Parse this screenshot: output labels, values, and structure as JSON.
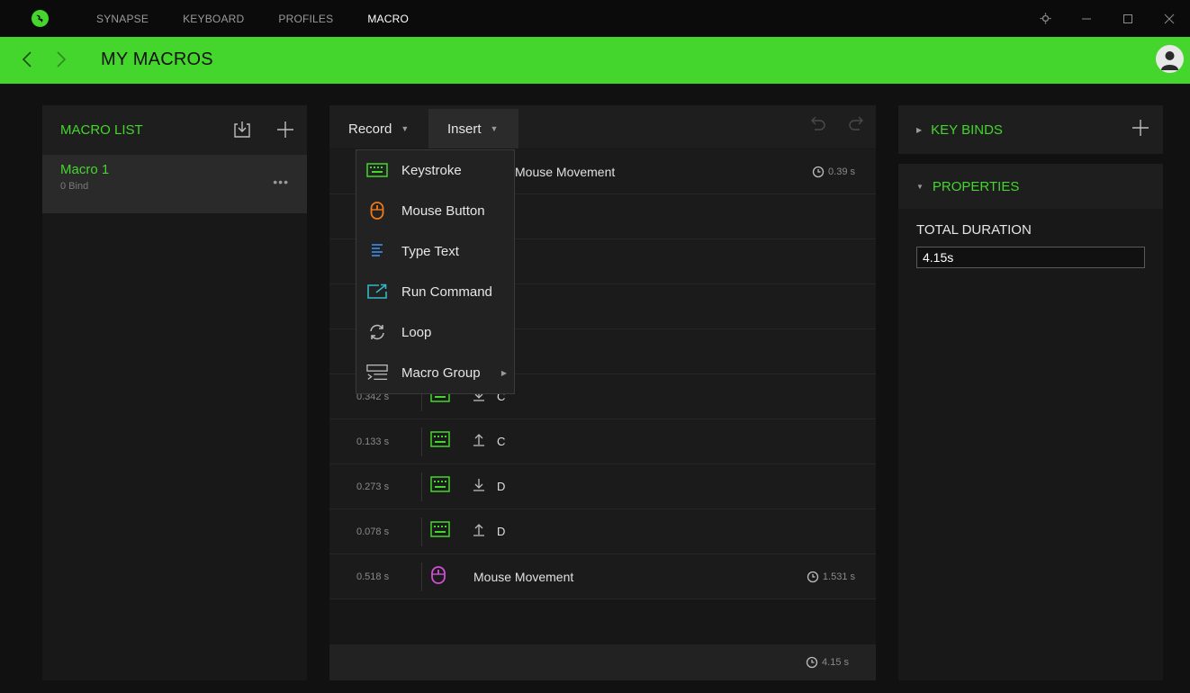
{
  "topnav": {
    "tabs": [
      {
        "label": "SYNAPSE"
      },
      {
        "label": "KEYBOARD"
      },
      {
        "label": "PROFILES"
      },
      {
        "label": "MACRO"
      }
    ]
  },
  "header": {
    "title": "MY MACROS"
  },
  "macro_list": {
    "title": "MACRO LIST",
    "items": [
      {
        "name": "Macro 1",
        "sub": "0 Bind",
        "more": "•••"
      }
    ]
  },
  "editor": {
    "record_label": "Record",
    "insert_label": "Insert",
    "rows": [
      {
        "time": "",
        "label": "Mouse Movement",
        "duration": "0.39 s",
        "type": "mouse"
      },
      {
        "time": "",
        "key": "",
        "type": "blank"
      },
      {
        "time": "",
        "key": "",
        "type": "blank"
      },
      {
        "time": "",
        "key": "",
        "type": "blank"
      },
      {
        "time": "",
        "key": "",
        "type": "blank"
      },
      {
        "time": "0.342 s",
        "key": "C",
        "dir": "down",
        "type": "key"
      },
      {
        "time": "0.133 s",
        "key": "C",
        "dir": "up",
        "type": "key"
      },
      {
        "time": "0.273 s",
        "key": "D",
        "dir": "down",
        "type": "key"
      },
      {
        "time": "0.078 s",
        "key": "D",
        "dir": "up",
        "type": "key"
      },
      {
        "time": "0.518 s",
        "label": "Mouse Movement",
        "duration": "1.531 s",
        "type": "mouse"
      }
    ],
    "total": "4.15 s"
  },
  "insert_menu": {
    "items": [
      {
        "label": "Keystroke",
        "icon": "keyboard-icon"
      },
      {
        "label": "Mouse Button",
        "icon": "mouse-icon"
      },
      {
        "label": "Type Text",
        "icon": "text-icon"
      },
      {
        "label": "Run Command",
        "icon": "run-command-icon"
      },
      {
        "label": "Loop",
        "icon": "loop-icon"
      },
      {
        "label": "Macro Group",
        "icon": "macro-group-icon"
      }
    ]
  },
  "keybinds": {
    "title": "KEY BINDS"
  },
  "properties": {
    "title": "PROPERTIES",
    "total_duration_label": "TOTAL DURATION",
    "total_duration_value": "4.15s"
  },
  "colors": {
    "accent": "#44d62c",
    "mouse_orange": "#f07a1a",
    "mouse_pink": "#d04fd6",
    "text_blue": "#3b8ef0",
    "run_teal": "#35b8c8"
  }
}
